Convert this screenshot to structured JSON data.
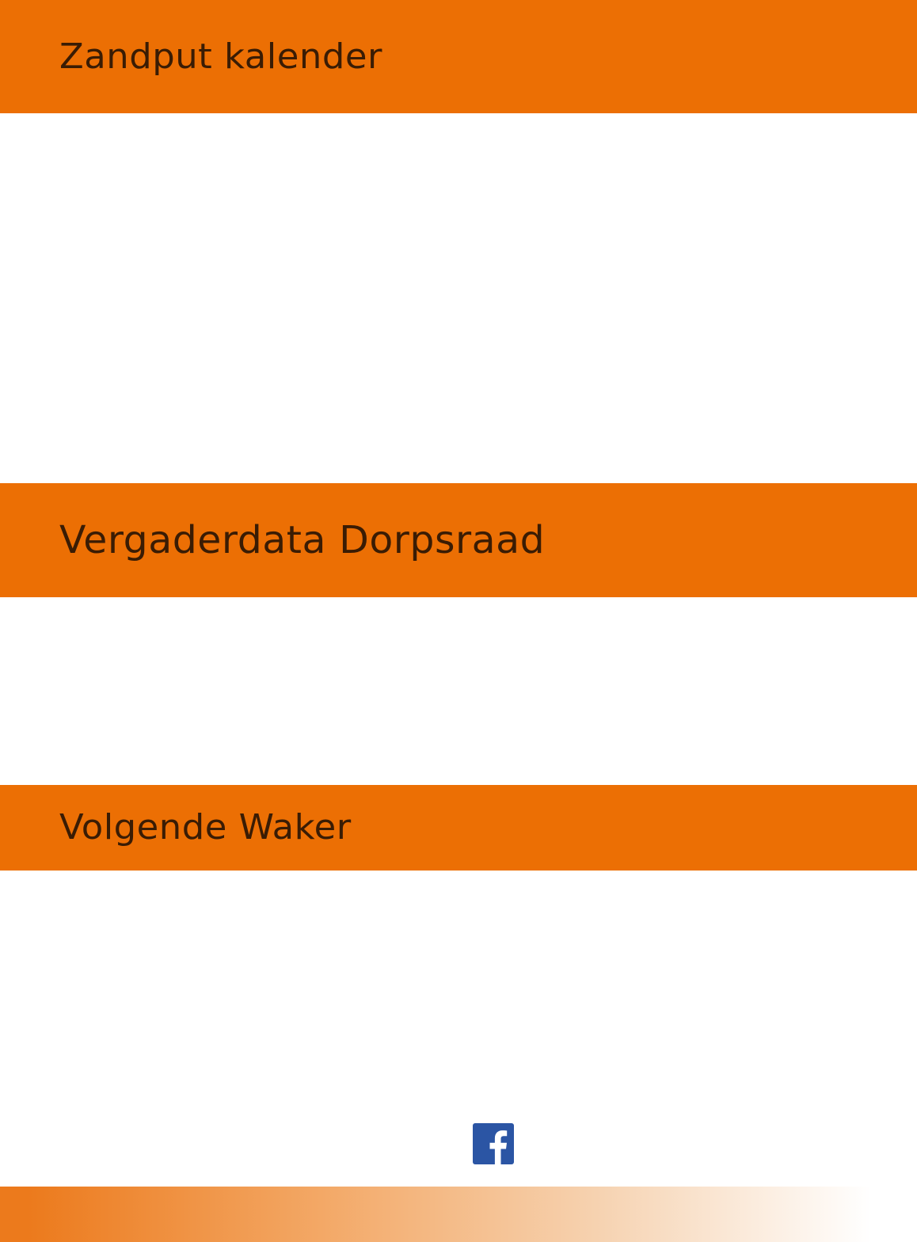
{
  "sections": [
    {
      "title": "Zandput kalender"
    },
    {
      "title": "Vergaderdata Dorpsraad"
    },
    {
      "title": "Volgende Waker"
    }
  ],
  "social": {
    "icon": "facebook-icon",
    "color": "#2b55a4"
  },
  "colors": {
    "accent": "#ec6f04",
    "heading_text": "#3a1c04",
    "footer_gradient_start": "#ec7a1c",
    "footer_gradient_end": "#ffffff"
  }
}
